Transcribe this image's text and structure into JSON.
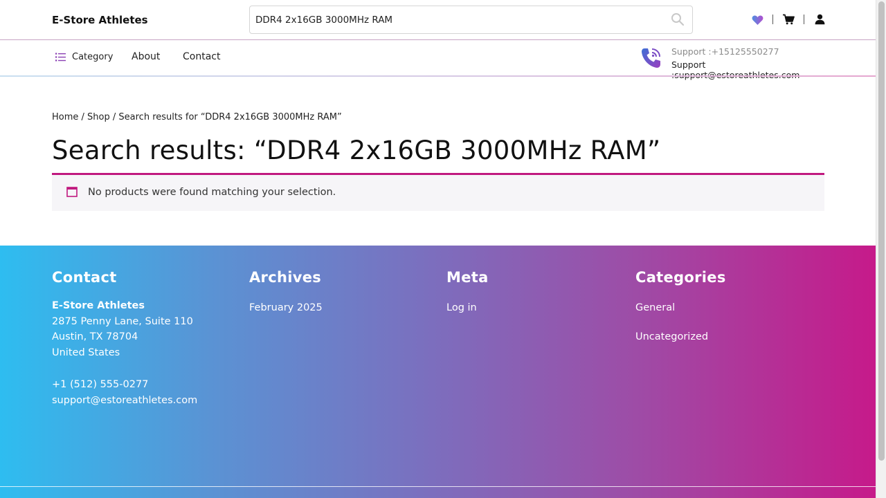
{
  "header": {
    "site_title": "E-Store Athletes",
    "search": {
      "value": "DDR4 2x16GB 3000MHz RAM",
      "placeholder": ""
    },
    "icons": [
      "heart-icon",
      "cart-icon",
      "user-icon"
    ]
  },
  "nav": {
    "category_label": "Category",
    "links": [
      "About",
      "Contact"
    ]
  },
  "support": {
    "phone_line": "Support :+15125550277",
    "email_line": "Support :support@estoreathletes.com"
  },
  "breadcrumb": {
    "home": "Home",
    "sep1": " / ",
    "shop": "Shop",
    "sep2": " / ",
    "current": "Search results for “DDR4 2x16GB 3000MHz RAM”"
  },
  "page_title": "Search results: “DDR4 2x16GB 3000MHz RAM”",
  "notice": {
    "text": "No products were found matching your selection."
  },
  "footer": {
    "contact": {
      "heading": "Contact",
      "name": "E-Store Athletes",
      "address1": "2875 Penny Lane, Suite 110",
      "address2": "Austin, TX 78704",
      "country": "United States",
      "phone": "+1 (512) 555-0277",
      "email": "support@estoreathletes.com"
    },
    "archives": {
      "heading": "Archives",
      "items": [
        "February 2025"
      ]
    },
    "meta": {
      "heading": "Meta",
      "items": [
        "Log in"
      ]
    },
    "categories": {
      "heading": "Categories",
      "items": [
        "General",
        "Uncategorized"
      ]
    }
  },
  "colors": {
    "accent": "#c0197f",
    "footer_gradient_start": "#2ebdf0",
    "footer_gradient_end": "#c61a8a"
  }
}
